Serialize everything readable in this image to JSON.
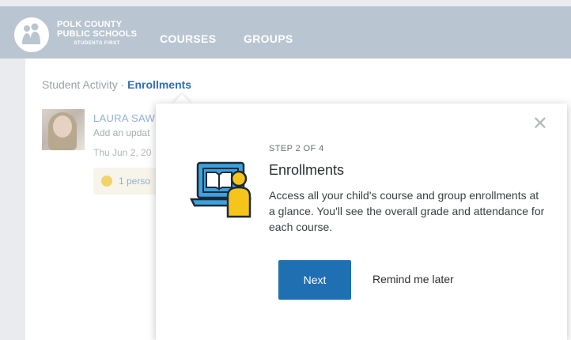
{
  "header": {
    "logo": {
      "line1": "POLK COUNTY",
      "line2": "PUBLIC SCHOOLS",
      "line3": "STUDENTS FIRST"
    },
    "nav": [
      {
        "label": "COURSES"
      },
      {
        "label": "GROUPS"
      }
    ]
  },
  "breadcrumb": {
    "parent": "Student Activity",
    "separator": " · ",
    "current": "Enrollments"
  },
  "post": {
    "author": "LAURA SAW",
    "text": "Add an updat",
    "date": "Thu Jun 2, 20",
    "reaction": "1 perso"
  },
  "tour": {
    "step": "STEP 2 OF 4",
    "title": "Enrollments",
    "description": "Access all your child's course and group enrollments at a glance. You'll see the overall grade and attendance for each course.",
    "next_label": "Next",
    "remind_label": "Remind me later",
    "close_symbol": "✕"
  },
  "colors": {
    "header_bg": "#b9c6d1",
    "accent_blue": "#1f6fb3",
    "link_blue": "#2f6eb5",
    "illustration_yellow": "#f6c51a",
    "illustration_blue": "#3ba3dc"
  }
}
